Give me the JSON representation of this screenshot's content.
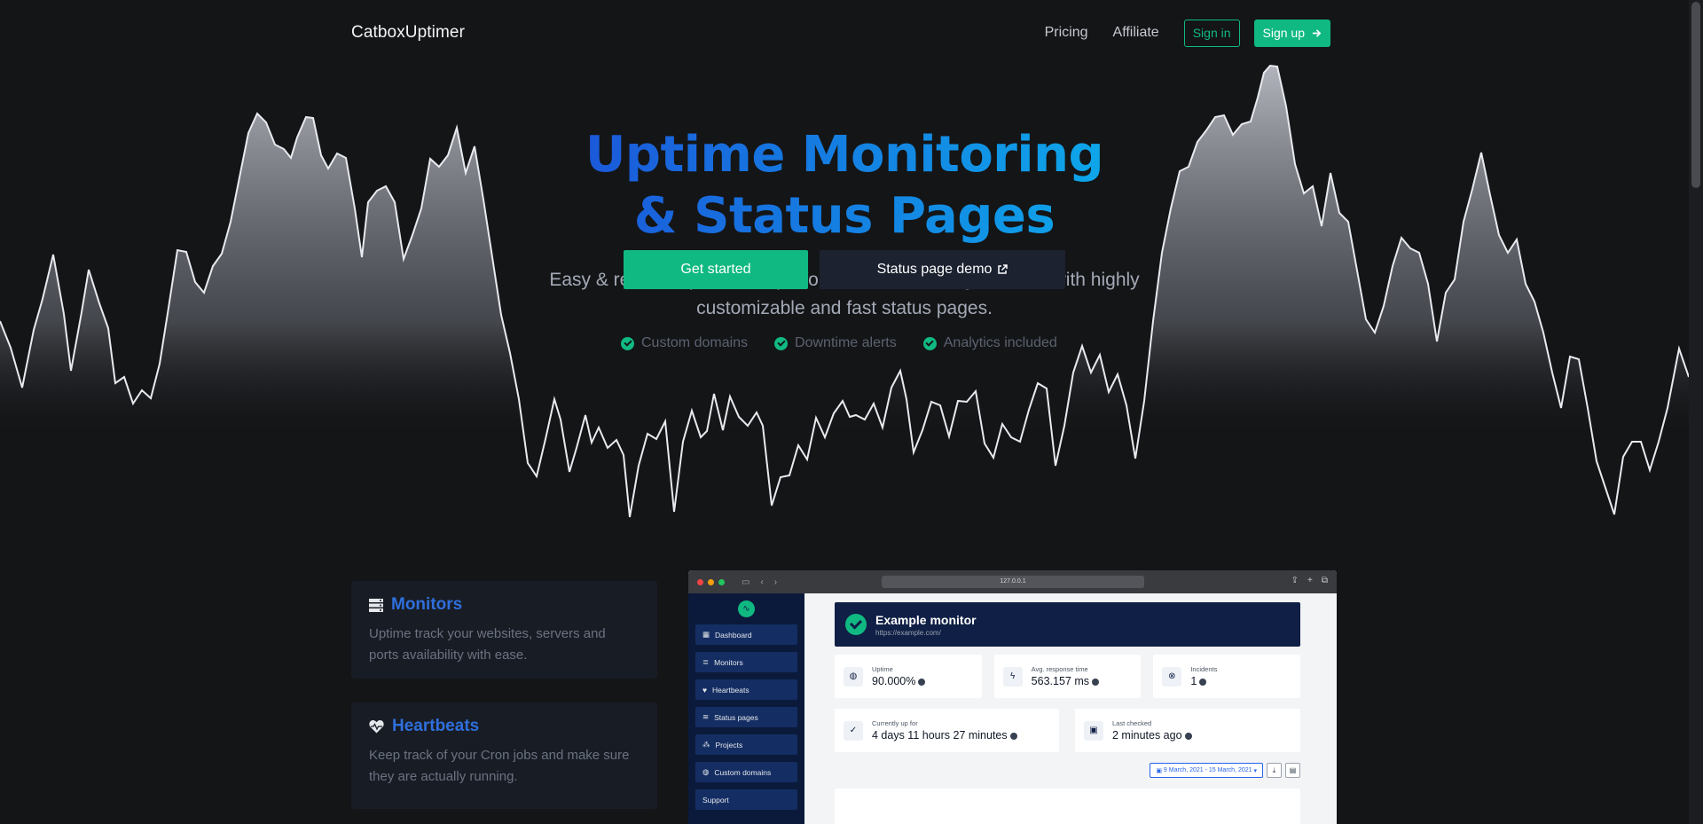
{
  "nav": {
    "brand": "CatboxUptimer",
    "links": [
      "Pricing",
      "Affiliate"
    ],
    "signin": "Sign in",
    "signup": "Sign up"
  },
  "hero": {
    "title_line1": "Uptime Monitoring",
    "title_line2": "& Status Pages",
    "subtitle_line1": "Easy & reliable uptime and performance monitoring solution, with highly",
    "subtitle_line2": "customizable and fast status pages.",
    "cta_primary": "Get started",
    "cta_secondary": "Status page demo",
    "features": [
      "Custom domains",
      "Downtime alerts",
      "Analytics included"
    ]
  },
  "cards": [
    {
      "title": "Monitors",
      "desc_line1": "Uptime track your websites, servers and",
      "desc_line2": "ports availability with ease."
    },
    {
      "title": "Heartbeats",
      "desc_line1": "Keep track of your Cron jobs and make sure",
      "desc_line2": "they are actually running."
    }
  ],
  "mock": {
    "url": "127.0.0.1",
    "sidebar": [
      "Dashboard",
      "Monitors",
      "Heartbeats",
      "Status pages",
      "Projects",
      "Custom domains",
      "Support"
    ],
    "monitor_title": "Example monitor",
    "monitor_url": "https://example.com/",
    "stats": [
      {
        "label": "Uptime",
        "value": "90.000%"
      },
      {
        "label": "Avg. response time",
        "value": "563.157 ms"
      },
      {
        "label": "Incidents",
        "value": "1"
      }
    ],
    "stats2": [
      {
        "label": "Currently up for",
        "value": "4 days 11 hours 27 minutes"
      },
      {
        "label": "Last checked",
        "value": "2 minutes ago"
      }
    ],
    "date_range": "9 March, 2021 - 15 March, 2021"
  },
  "colors": {
    "accent": "#10b981",
    "background": "#141517",
    "card": "#181c25",
    "link_blue": "#2f6fdb"
  }
}
